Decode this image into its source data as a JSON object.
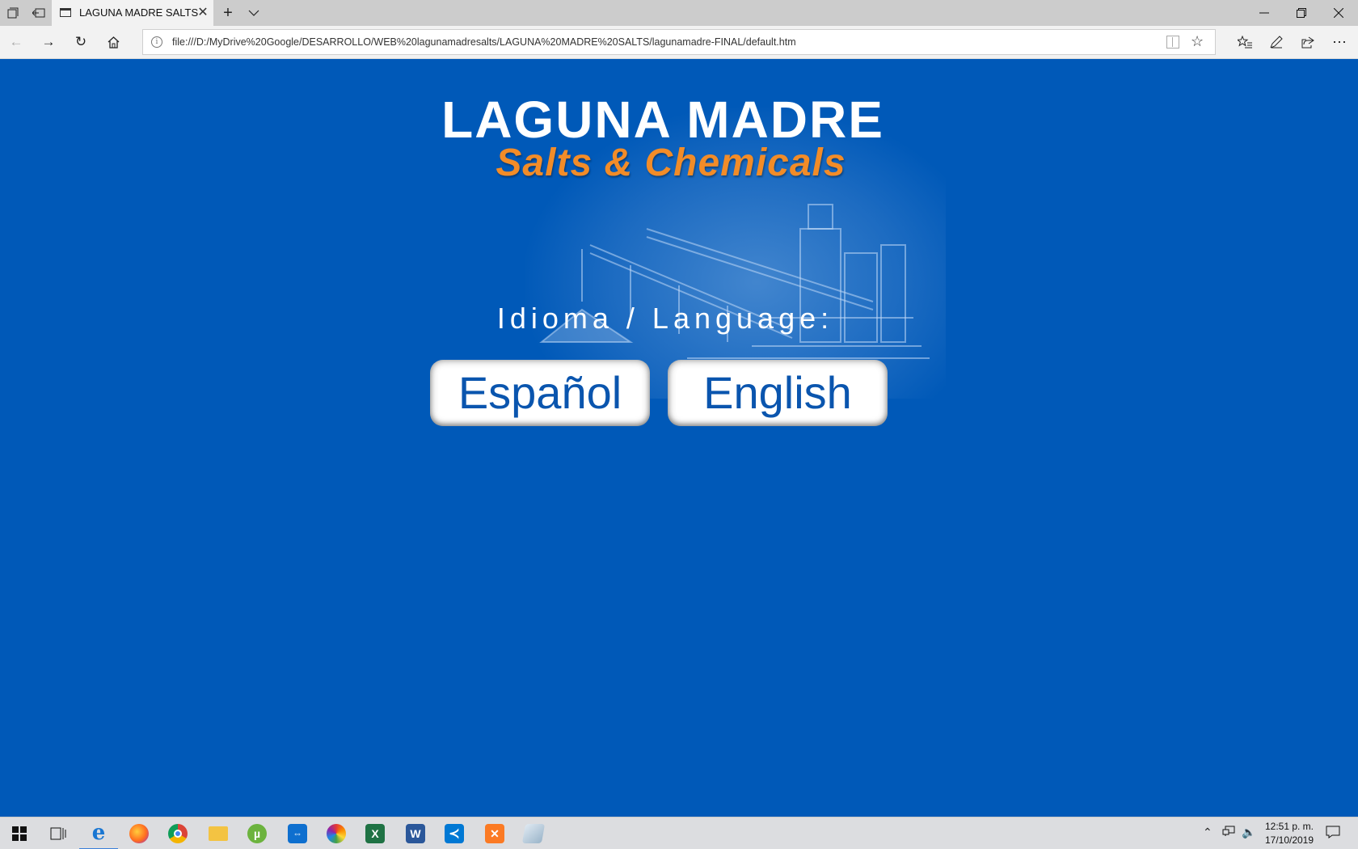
{
  "browser": {
    "tab": {
      "title": "LAGUNA MADRE SALTS"
    },
    "address": {
      "url": "file:///D:/MyDrive%20Google/DESARROLLO/WEB%20lagunamadresalts/LAGUNA%20MADRE%20SALTS/lagunamadre-FINAL/default.htm"
    },
    "icons": [
      "tab-preview-icon",
      "set-aside-tabs-icon",
      "page-icon",
      "close-icon",
      "new-tab-icon",
      "chevron-down-icon",
      "minimize-icon",
      "restore-icon",
      "close-window-icon",
      "back-icon",
      "forward-icon",
      "refresh-icon",
      "home-icon",
      "info-icon",
      "reading-view-icon",
      "favorite-star-icon",
      "favorites-list-icon",
      "pen-icon",
      "share-icon",
      "more-icon"
    ]
  },
  "page": {
    "logo": {
      "title": "LAGUNA MADRE",
      "subtitle": "Salts & Chemicals"
    },
    "prompt": "Idioma / Language:",
    "buttons": {
      "spanish": "Español",
      "english": "English"
    },
    "colors": {
      "background": "#0059b8",
      "title": "#ffffff",
      "subtitle": "#f28c28",
      "button_text": "#0a55ae"
    }
  },
  "taskbar": {
    "apps": [
      "start-windows-icon",
      "task-view-icon",
      "edge-icon",
      "firefox-icon",
      "chrome-icon",
      "file-explorer-icon",
      "utorrent-icon",
      "teamviewer-icon",
      "photos-icon",
      "excel-icon",
      "word-icon",
      "vscode-icon",
      "xampp-icon",
      "notes-icon"
    ],
    "clock": {
      "time": "12:51 p. m.",
      "date": "17/10/2019"
    }
  }
}
